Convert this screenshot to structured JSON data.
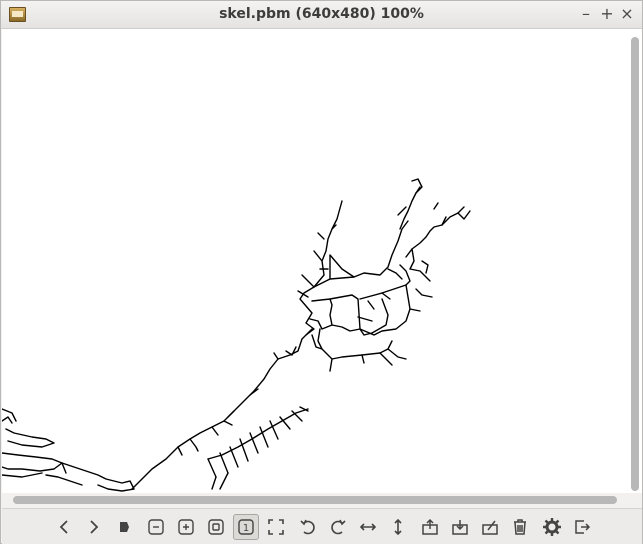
{
  "window": {
    "title": "skel.pbm (640x480) 100%",
    "icon": "image-viewer-app-icon",
    "controls": {
      "minimize": "–",
      "maximize": "+",
      "close": "×"
    }
  },
  "toolbar": {
    "buttons": [
      {
        "icon": "previous-icon"
      },
      {
        "icon": "next-icon"
      },
      {
        "icon": "slideshow-play-icon"
      },
      {
        "icon": "zoom-out-icon"
      },
      {
        "icon": "zoom-in-icon"
      },
      {
        "icon": "zoom-fit-icon"
      },
      {
        "icon": "zoom-original-1-1-icon",
        "active": true,
        "label": "1"
      },
      {
        "icon": "fullscreen-icon"
      },
      {
        "icon": "rotate-left-icon"
      },
      {
        "icon": "rotate-right-icon"
      },
      {
        "icon": "flip-horizontal-icon"
      },
      {
        "icon": "flip-vertical-icon"
      },
      {
        "icon": "open-file-icon"
      },
      {
        "icon": "save-file-icon"
      },
      {
        "icon": "save-as-icon"
      },
      {
        "icon": "delete-icon"
      },
      {
        "icon": "preferences-gear-icon"
      },
      {
        "icon": "quit-icon"
      }
    ]
  },
  "colors": {
    "skeleton": "#000000",
    "canvas": "#ffffff",
    "chrome": "#f2f1f0"
  }
}
